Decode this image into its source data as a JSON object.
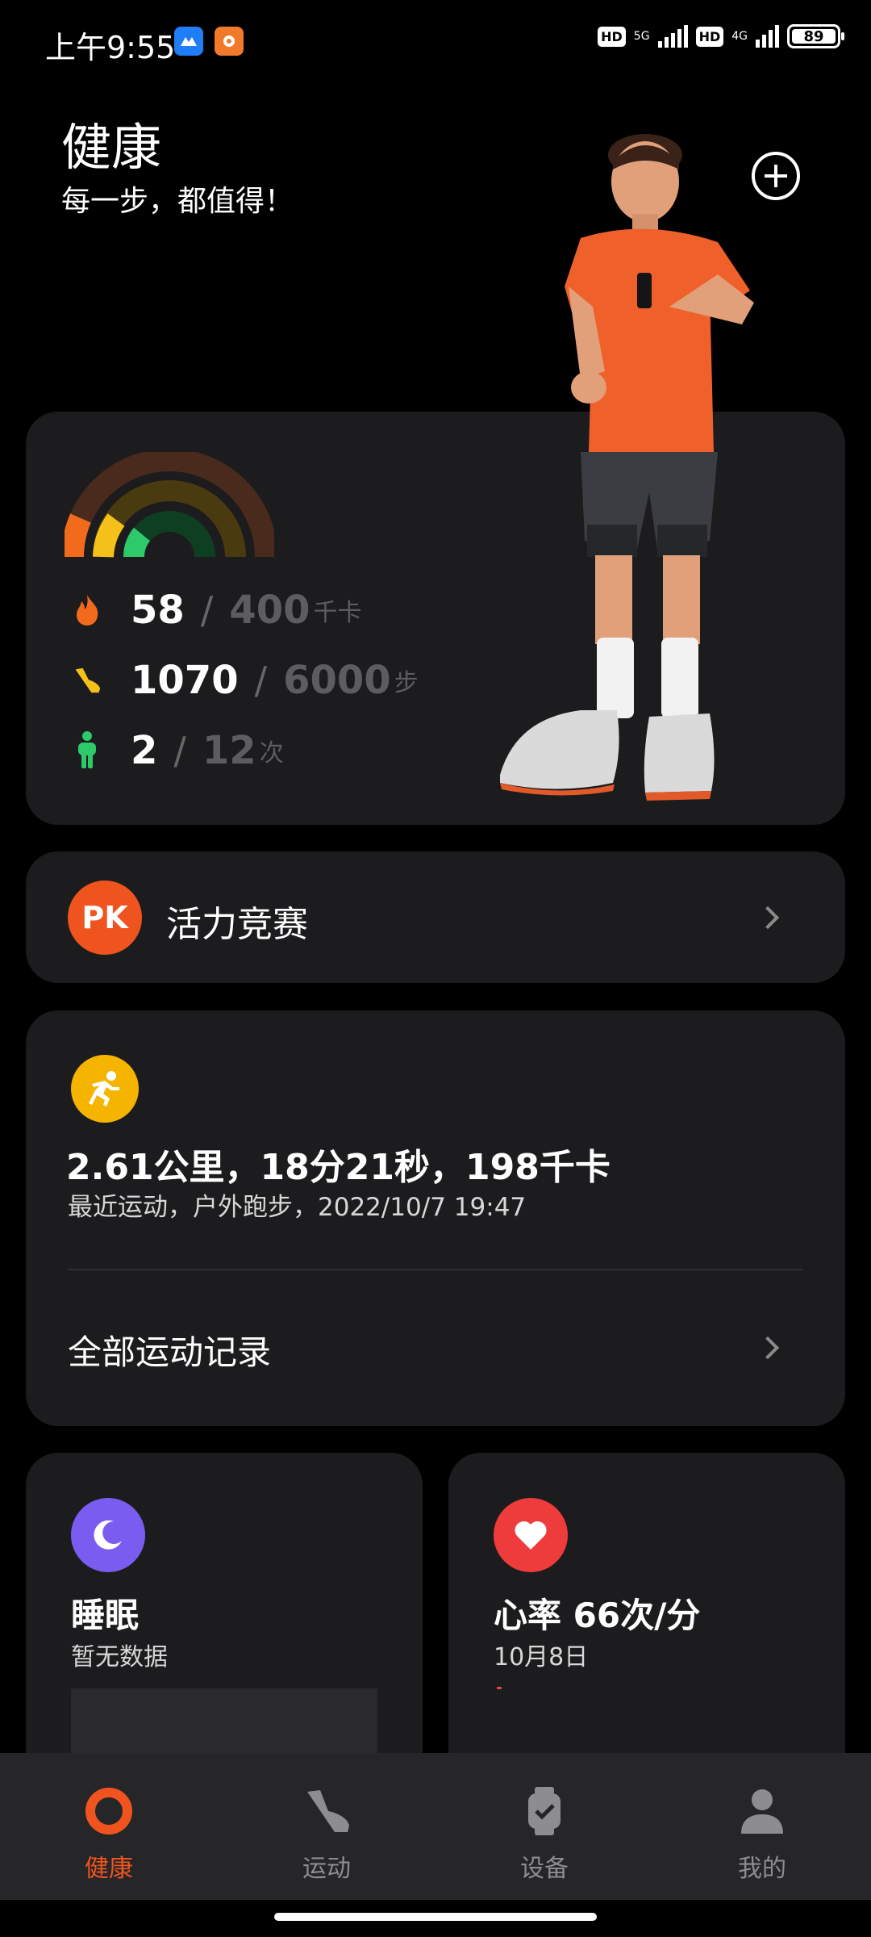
{
  "status_bar": {
    "time": "上午9:55",
    "hd1": "HD",
    "net1": "5G",
    "hd2": "HD",
    "net2": "4G",
    "battery": "89"
  },
  "header": {
    "title": "健康",
    "subtitle": "每一步，都值得！"
  },
  "activity": {
    "calories": {
      "value": "58",
      "goal": "400",
      "unit": "千卡",
      "color": "#f26b1d"
    },
    "steps": {
      "value": "1070",
      "goal": "6000",
      "unit": "步",
      "color": "#f4c01a"
    },
    "stand": {
      "value": "2",
      "goal": "12",
      "unit": "次",
      "color": "#2ec96b"
    },
    "separator": "/"
  },
  "pk": {
    "badge": "PK",
    "label": "活力竞赛"
  },
  "workout": {
    "summary": "2.61公里，18分21秒，198千卡",
    "detail": "最近运动，户外跑步，2022/10/7 19:47",
    "all_records": "全部运动记录"
  },
  "sleep": {
    "title": "睡眠",
    "sub": "暂无数据",
    "color": "#7b5cf0"
  },
  "heart": {
    "title": "心率 66次/分",
    "sub": "10月8日",
    "color": "#ee3b3b"
  },
  "nav": {
    "items": [
      {
        "label": "健康",
        "icon": "ring-icon",
        "active": true
      },
      {
        "label": "运动",
        "icon": "shoe-icon",
        "active": false
      },
      {
        "label": "设备",
        "icon": "watch-icon",
        "active": false
      },
      {
        "label": "我的",
        "icon": "person-icon",
        "active": false
      }
    ]
  }
}
